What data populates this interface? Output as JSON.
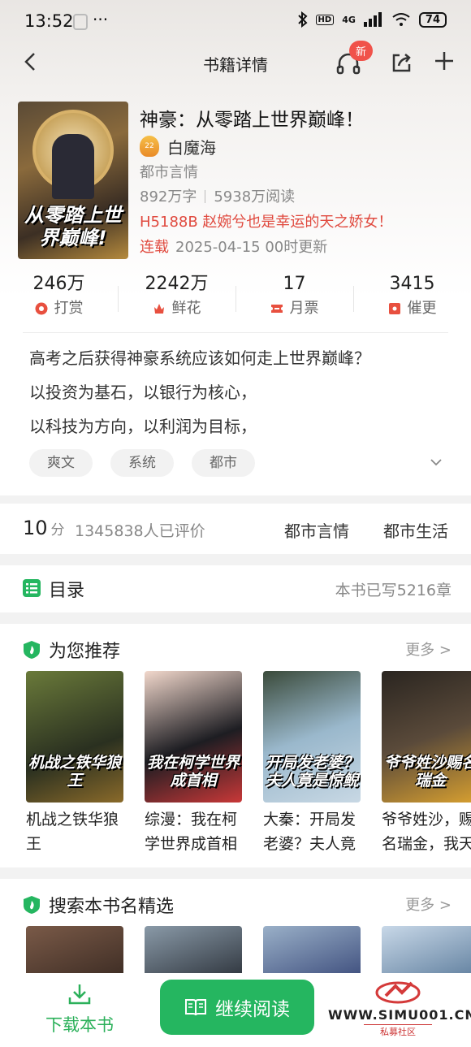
{
  "status_bar": {
    "time": "13:52",
    "dots": "···",
    "network": "4G",
    "battery": "74"
  },
  "nav": {
    "title": "书籍详情",
    "badge": "新"
  },
  "book": {
    "title": "神豪：从零踏上世界巅峰！",
    "author": "白魔海",
    "level": "22",
    "category": "都市言情",
    "words": "892万字",
    "reads": "5938万阅读",
    "latest_chapter": "H5188B 赵婉兮也是幸运的天之娇女！",
    "serial_status": "连载",
    "update_time": "2025-04-15 00时更新",
    "cover_title": "从零踏上世界巅峰!"
  },
  "stats": [
    {
      "value": "246万",
      "label": "打赏",
      "icon": "reward-icon"
    },
    {
      "value": "2242万",
      "label": "鲜花",
      "icon": "flower-icon"
    },
    {
      "value": "17",
      "label": "月票",
      "icon": "ticket-icon"
    },
    {
      "value": "3415",
      "label": "催更",
      "icon": "urge-icon"
    }
  ],
  "description": [
    "高考之后获得神豪系统应该如何走上世界巅峰？",
    "以投资为基石，以银行为核心，",
    "以科技为方向，以利润为目标，"
  ],
  "tags": [
    "爽文",
    "系统",
    "都市"
  ],
  "rating": {
    "score": "10",
    "unit": "分",
    "count": "1345838人已评价",
    "categories": [
      "都市言情",
      "都市生活"
    ]
  },
  "toc": {
    "label": "目录",
    "chapters": "本书已写5216章"
  },
  "recommend": {
    "title": "为您推荐",
    "more": "更多 >",
    "books": [
      {
        "name": "机战之铁华狼王",
        "cover_text": "机战之铁华狼王",
        "color": "#3b4a2a"
      },
      {
        "name": "综漫：我在柯学世界成首相",
        "cover_text": "我在柯学世界成首相",
        "color": "#c23a3a"
      },
      {
        "name": "大秦：开局发老婆？夫人竟是惊鲵",
        "cover_text": "开局发老婆？夫人竟是惊鲵",
        "color": "#6a8aa8"
      },
      {
        "name": "爷爷姓沙，赐名瑞金，我天生富贵",
        "cover_text": "爷爷姓沙赐名瑞金",
        "color": "#4a4038"
      }
    ]
  },
  "search_picks": {
    "title": "搜索本书名精选",
    "more": "更多 >",
    "colors": [
      "#5a3a30",
      "#3a4a5a",
      "#4a5a8a",
      "#5a7a9a"
    ]
  },
  "bottom": {
    "download": "下载本书",
    "read": "继续阅读"
  },
  "watermark": {
    "site": "WWW.SIMU001.CN",
    "sub": "私募社区"
  },
  "colors": {
    "accent": "#25b660",
    "red": "#e04a3f"
  }
}
